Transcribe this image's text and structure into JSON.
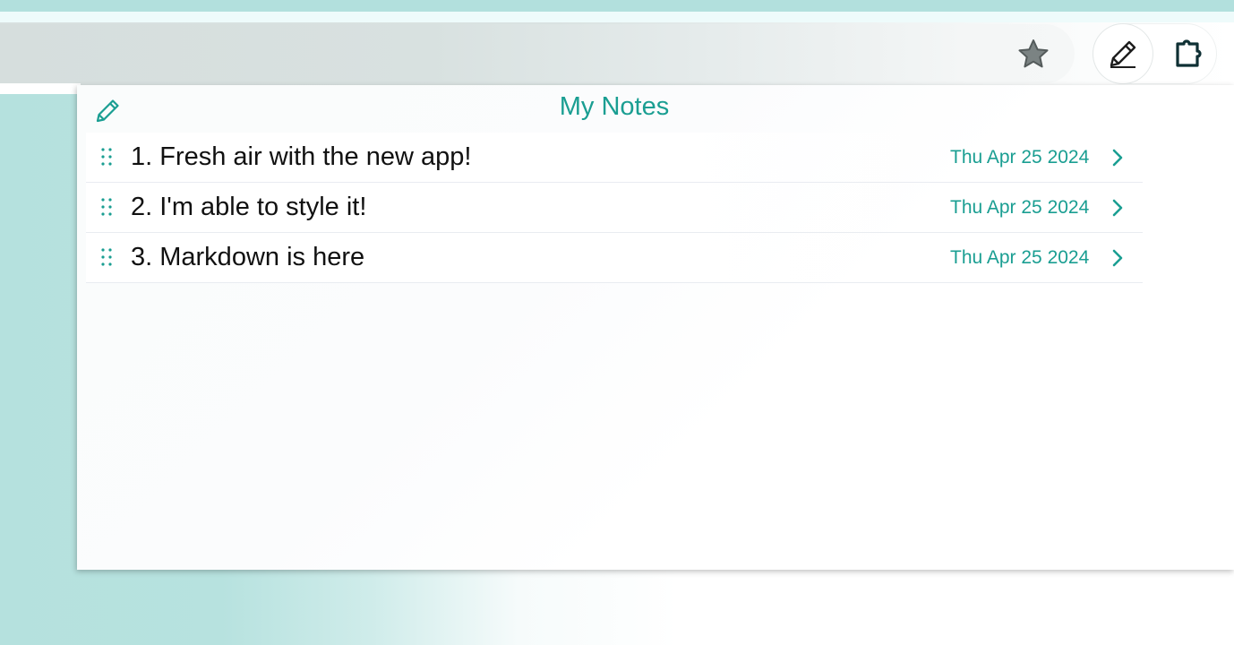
{
  "browser": {
    "bookmark_icon": "star-icon",
    "extensions": [
      {
        "icon": "pencil-icon",
        "active": true
      },
      {
        "icon": "puzzle-icon",
        "active": false
      }
    ]
  },
  "popup": {
    "title": "My Notes",
    "edit_icon": "pencil-icon",
    "accent_color": "#1a9e92",
    "notes": [
      {
        "title": "1. Fresh air with the new app!",
        "date": "Thu Apr 25 2024"
      },
      {
        "title": "2. I'm able to style it!",
        "date": "Thu Apr 25 2024"
      },
      {
        "title": "3. Markdown is here",
        "date": "Thu Apr 25 2024"
      }
    ]
  }
}
